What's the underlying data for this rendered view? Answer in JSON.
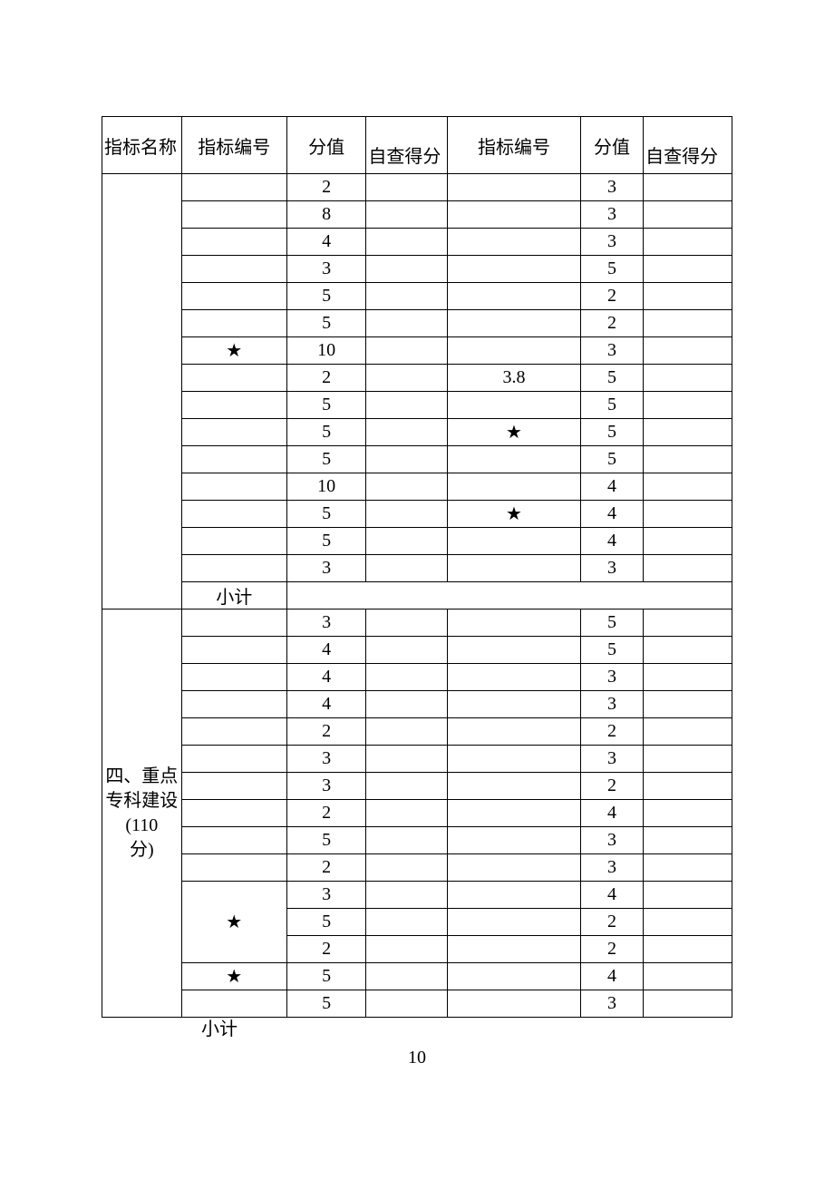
{
  "headers": {
    "c1": "指标名称",
    "c2": "指标编号",
    "c3": "分值",
    "c4": "自查得分",
    "c5": "指标编号",
    "c6": "分值",
    "c7": "自查得分"
  },
  "section1": {
    "rows": [
      {
        "b": "",
        "c": "2",
        "d": "",
        "e": "",
        "f": "3",
        "g": ""
      },
      {
        "b": "",
        "c": "8",
        "d": "",
        "e": "",
        "f": "3",
        "g": ""
      },
      {
        "b": "",
        "c": "4",
        "d": "",
        "e": "",
        "f": "3",
        "g": ""
      },
      {
        "b": "",
        "c": "3",
        "d": "",
        "e": "",
        "f": "5",
        "g": ""
      },
      {
        "b": "",
        "c": "5",
        "d": "",
        "e": "",
        "f": "2",
        "g": ""
      },
      {
        "b": "",
        "c": "5",
        "d": "",
        "e": "",
        "f": "2",
        "g": ""
      },
      {
        "b": "★",
        "c": "10",
        "d": "",
        "e": "",
        "f": "3",
        "g": ""
      },
      {
        "b": "",
        "c": "2",
        "d": "",
        "e": "3.8",
        "f": "5",
        "g": ""
      },
      {
        "b": "",
        "c": "5",
        "d": "",
        "e": "",
        "f": "5",
        "g": ""
      },
      {
        "b": "",
        "c": "5",
        "d": "",
        "e": "★",
        "f": "5",
        "g": ""
      },
      {
        "b": "",
        "c": "5",
        "d": "",
        "e": "",
        "f": "5",
        "g": ""
      },
      {
        "b": "",
        "c": "10",
        "d": "",
        "e": "",
        "f": "4",
        "g": ""
      },
      {
        "b": "",
        "c": "5",
        "d": "",
        "e": "★",
        "f": "4",
        "g": ""
      },
      {
        "b": "",
        "c": "5",
        "d": "",
        "e": "",
        "f": "4",
        "g": ""
      },
      {
        "b": "",
        "c": "3",
        "d": "",
        "e": "",
        "f": "3",
        "g": ""
      }
    ],
    "subtotal_label": "小计"
  },
  "section2": {
    "label_lines": [
      "四、重点",
      "专科建设",
      "(110",
      "分)"
    ],
    "rows": [
      {
        "b": "",
        "c": "3",
        "d": "",
        "e": "",
        "f": "5",
        "g": ""
      },
      {
        "b": "",
        "c": "4",
        "d": "",
        "e": "",
        "f": "5",
        "g": ""
      },
      {
        "b": "",
        "c": "4",
        "d": "",
        "e": "",
        "f": "3",
        "g": ""
      },
      {
        "b": "",
        "c": "4",
        "d": "",
        "e": "",
        "f": "3",
        "g": ""
      },
      {
        "b": "",
        "c": "2",
        "d": "",
        "e": "",
        "f": "2",
        "g": ""
      },
      {
        "b": "",
        "c": "3",
        "d": "",
        "e": "",
        "f": "3",
        "g": ""
      },
      {
        "b": "",
        "c": "3",
        "d": "",
        "e": "",
        "f": "2",
        "g": ""
      },
      {
        "b": "",
        "c": "2",
        "d": "",
        "e": "",
        "f": "4",
        "g": ""
      },
      {
        "b": "",
        "c": "5",
        "d": "",
        "e": "",
        "f": "3",
        "g": ""
      },
      {
        "b": "",
        "c": "2",
        "d": "",
        "e": "",
        "f": "3",
        "g": ""
      },
      {
        "b": "",
        "c": "3",
        "d": "",
        "e": "",
        "f": "4",
        "g": "",
        "b_rowspan": 3,
        "b_text": "★"
      },
      {
        "c": "5",
        "d": "",
        "e": "",
        "f": "2",
        "g": ""
      },
      {
        "c": "2",
        "d": "",
        "e": "",
        "f": "2",
        "g": ""
      },
      {
        "b": "★",
        "c": "5",
        "d": "",
        "e": "",
        "f": "4",
        "g": ""
      },
      {
        "b": "",
        "c": "5",
        "d": "",
        "e": "",
        "f": "3",
        "g": ""
      }
    ]
  },
  "hanging_subtotal": "小计",
  "page_number": "10"
}
